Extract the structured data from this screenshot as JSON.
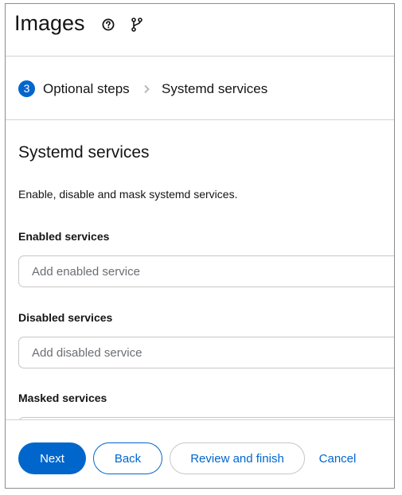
{
  "header": {
    "title": "Images",
    "help_icon": "help-circle-icon",
    "branch_icon": "code-branch-icon"
  },
  "breadcrumb": {
    "step_number": "3",
    "step_label": "Optional steps",
    "separator_icon": "chevron-right-icon",
    "current": "Systemd services"
  },
  "section": {
    "title": "Systemd services",
    "description": "Enable, disable and mask systemd services."
  },
  "fields": {
    "enabled": {
      "label": "Enabled services",
      "placeholder": "Add enabled service"
    },
    "disabled": {
      "label": "Disabled services",
      "placeholder": "Add disabled service"
    },
    "masked": {
      "label": "Masked services",
      "placeholder": ""
    }
  },
  "footer": {
    "next": "Next",
    "back": "Back",
    "review": "Review and finish",
    "cancel": "Cancel"
  },
  "colors": {
    "accent": "#0066cc",
    "border": "#d2d2d2"
  }
}
